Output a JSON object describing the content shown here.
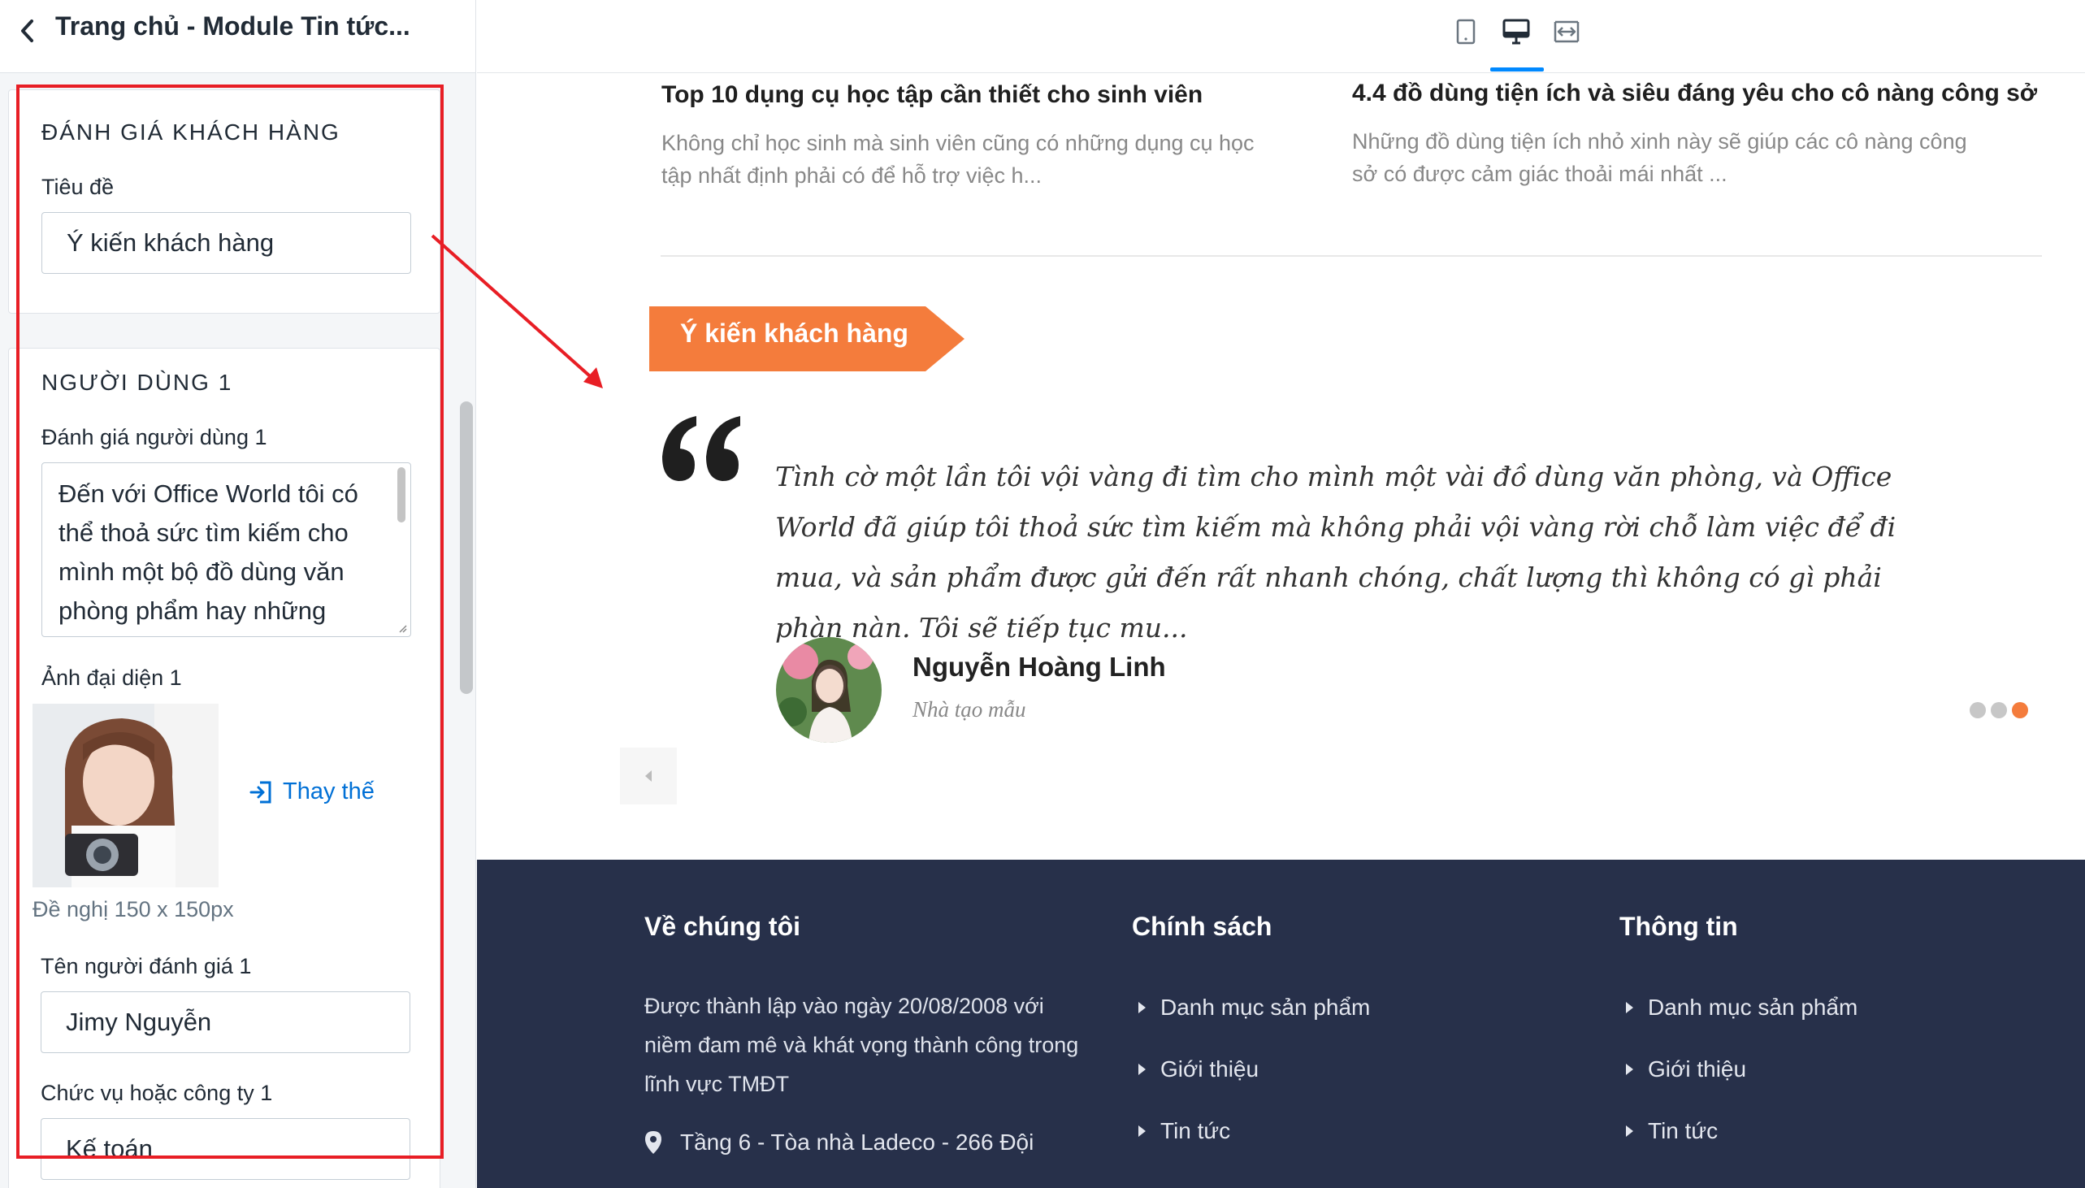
{
  "sidebar": {
    "title": "Trang chủ - Module Tin tức...",
    "review_section": {
      "heading": "ĐÁNH GIÁ KHÁCH HÀNG",
      "title_label": "Tiêu đề",
      "title_value": "Ý kiến khách hàng"
    },
    "user1": {
      "heading": "NGƯỜI DÙNG 1",
      "review_label": "Đánh giá người dùng 1",
      "review_value": "Đến với Office World tôi có thể thoả sức tìm kiếm cho mình một bộ đồ dùng văn phòng phẩm hay những",
      "avatar_label": "Ảnh đại diện 1",
      "replace_label": "Thay thế",
      "avatar_hint": "Đề nghị 150 x 150px",
      "name_label": "Tên người đánh giá 1",
      "name_value": "Jimy Nguyễn",
      "position_label": "Chức vụ hoặc công ty 1",
      "position_value": "Kế toán"
    }
  },
  "toolbar": {
    "devices": [
      "mobile-icon",
      "desktop-icon",
      "fullwidth-icon"
    ],
    "active_device": "desktop"
  },
  "preview": {
    "news": [
      {
        "title": "Top 10 dụng cụ học tập cần thiết cho sinh viên",
        "desc": "Không chỉ học sinh mà sinh viên cũng có những dụng cụ học tập nhất định phải có để hỗ trợ việc h..."
      },
      {
        "title": "4.4 đồ dùng tiện ích và siêu đáng yêu cho cô nàng công sở",
        "desc": "Những đồ dùng tiện ích nhỏ xinh này sẽ giúp các cô nàng công sở có được cảm giác thoải mái nhất ..."
      }
    ],
    "testimonial": {
      "section_title": "Ý kiến khách hàng",
      "quote": "Tình cờ một lần tôi vội vàng đi tìm cho mình một vài đồ dùng văn phòng, và Office World đã giúp tôi thoả sức tìm kiếm mà không phải vội vàng rời chỗ làm việc để đi mua, và sản phẩm được gửi đến rất nhanh chóng, chất lượng thì không có gì phải phàn nàn. Tôi sẽ tiếp tục mu...",
      "author_name": "Nguyễn Hoàng Linh",
      "author_role": "Nhà tạo mẫu",
      "slides_total": 3,
      "slides_active": 3
    }
  },
  "footer": {
    "about": {
      "heading": "Về chúng tôi",
      "text": "Được thành lập vào ngày 20/08/2008 với niềm đam mê và khát vọng thành công trong lĩnh vực TMĐT",
      "address": "Tầng 6 - Tòa nhà Ladeco - 266 Đội"
    },
    "policy": {
      "heading": "Chính sách",
      "links": [
        "Danh mục sản phẩm",
        "Giới thiệu",
        "Tin tức"
      ]
    },
    "info": {
      "heading": "Thông tin",
      "links": [
        "Danh mục sản phẩm",
        "Giới thiệu",
        "Tin tức"
      ]
    }
  },
  "colors": {
    "accent_orange": "#f47c3c",
    "highlight_red": "#e81e25",
    "link_blue": "#0070d6",
    "footer_navy": "#27304a"
  }
}
